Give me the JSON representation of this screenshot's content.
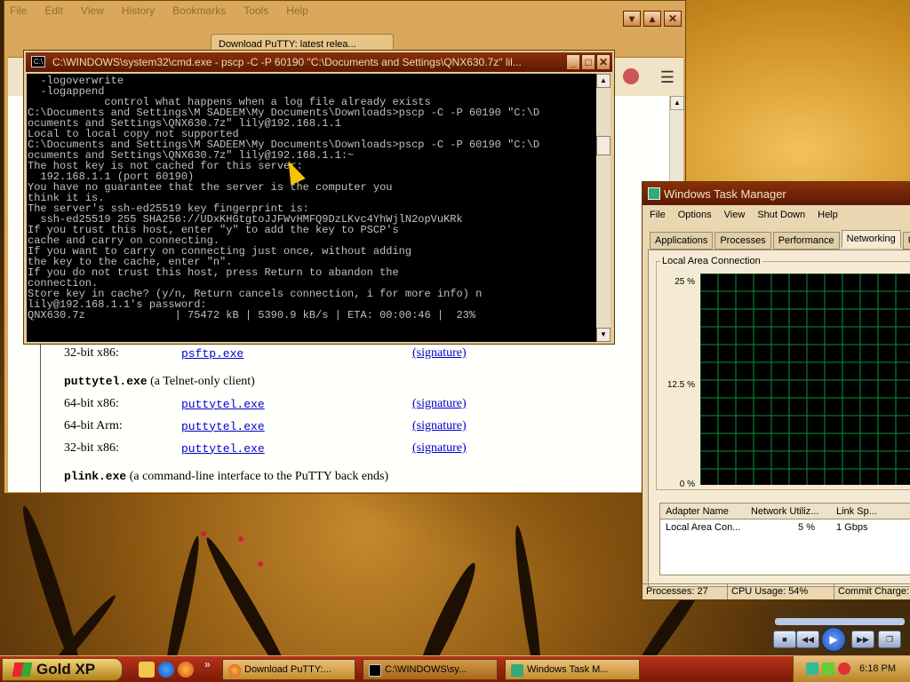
{
  "firefox": {
    "menu": [
      "File",
      "Edit",
      "View",
      "History",
      "Bookmarks",
      "Tools",
      "Help"
    ],
    "tabs": [
      {
        "label": "Download PuTTY: latest relea..."
      }
    ],
    "content": {
      "rows_top": [
        {
          "label": "32-bit x86:",
          "file": "psftp.exe",
          "sig": "(signature)"
        }
      ],
      "section_telnet": {
        "code": "puttytel.exe",
        "desc": "(a Telnet-only client)"
      },
      "rows_telnet": [
        {
          "label": "64-bit x86:",
          "file": "puttytel.exe",
          "sig": "(signature)"
        },
        {
          "label": "64-bit Arm:",
          "file": "puttytel.exe",
          "sig": "(signature)"
        },
        {
          "label": "32-bit x86:",
          "file": "puttytel.exe",
          "sig": "(signature)"
        }
      ],
      "section_plink": {
        "code": "plink.exe",
        "desc": "(a command-line interface to the PuTTY back ends)"
      }
    }
  },
  "cmd": {
    "title": "C:\\WINDOWS\\system32\\cmd.exe - pscp -C -P 60190 \"C:\\Documents and Settings\\QNX630.7z\" lil...",
    "lines": [
      "  -logoverwrite",
      "  -logappend",
      "            control what happens when a log file already exists",
      "",
      "C:\\Documents and Settings\\M SADEEM\\My Documents\\Downloads>pscp -C -P 60190 \"C:\\D",
      "ocuments and Settings\\QNX630.7z\" lily@192.168.1.1",
      "Local to local copy not supported",
      "",
      "C:\\Documents and Settings\\M SADEEM\\My Documents\\Downloads>pscp -C -P 60190 \"C:\\D",
      "ocuments and Settings\\QNX630.7z\" lily@192.168.1.1:~",
      "The host key is not cached for this server:",
      "  192.168.1.1 (port 60190)",
      "You have no guarantee that the server is the computer you",
      "think it is.",
      "The server's ssh-ed25519 key fingerprint is:",
      "  ssh-ed25519 255 SHA256://UDxKHGtgtoJJFWvHMFQ9DzLKvc4YhWjlN2opVuKRk",
      "If you trust this host, enter \"y\" to add the key to PSCP's",
      "cache and carry on connecting.",
      "If you want to carry on connecting just once, without adding",
      "the key to the cache, enter \"n\".",
      "If you do not trust this host, press Return to abandon the",
      "connection.",
      "Store key in cache? (y/n, Return cancels connection, i for more info) n",
      "lily@192.168.1.1's password:",
      "QNX630.7z              | 75472 kB | 5390.9 kB/s | ETA: 00:00:46 |  23%"
    ]
  },
  "taskmanager": {
    "title": "Windows Task Manager",
    "menu": [
      "File",
      "Options",
      "View",
      "Shut Down",
      "Help"
    ],
    "tabs": [
      "Applications",
      "Processes",
      "Performance",
      "Networking",
      "Use"
    ],
    "active_tab": "Networking",
    "graph_title": "Local Area Connection",
    "axis_labels": [
      "25 %",
      "12.5 %",
      "0 %"
    ],
    "table_headers": [
      "Adapter Name",
      "Network Utiliz...",
      "Link Sp..."
    ],
    "table_rows": [
      [
        "Local Area Con...",
        "5 %",
        "1 Gbps"
      ]
    ],
    "status": [
      "Processes: 27",
      "CPU Usage: 54%",
      "Commit Charge:"
    ]
  },
  "taskbar": {
    "start_label": "Gold XP",
    "tasks": [
      "Download PuTTY:...",
      "C:\\WINDOWS\\sy...",
      "Windows Task M..."
    ],
    "clock": "6:18 PM",
    "quicklaunch_more": "»"
  },
  "colors": {
    "title_bar": "#8a2f0b",
    "taskbar": "#b7331a",
    "graph_grid": "#0b8f3a",
    "link": "#0000cc"
  }
}
